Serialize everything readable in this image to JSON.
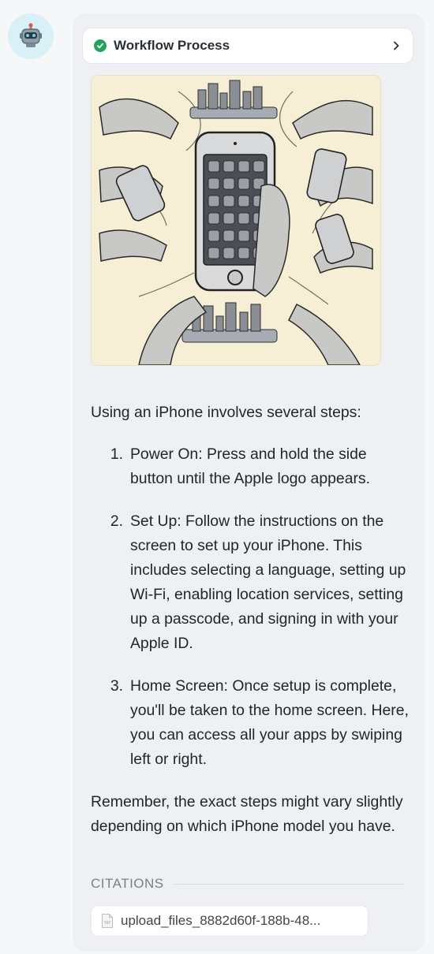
{
  "workflow": {
    "label": "Workflow Process",
    "status": "completed"
  },
  "hero_image": {
    "semantic": "iphone-usage-illustration"
  },
  "message": {
    "intro": "Using an iPhone involves several steps:",
    "steps": [
      {
        "num": "1.",
        "text": "Power On: Press and hold the side button until the Apple logo appears."
      },
      {
        "num": "2.",
        "text": "Set Up: Follow the instructions on the screen to set up your iPhone. This includes selecting a language, setting up Wi-Fi, enabling location services, setting up a passcode, and signing in with your Apple ID."
      },
      {
        "num": "3.",
        "text": "Home Screen: Once setup is complete, you'll be taken to the home screen. Here, you can access all your apps by swiping left or right."
      }
    ],
    "outro": "Remember, the exact steps might vary slightly depending on which iPhone model you have."
  },
  "citations": {
    "label": "CITATIONS",
    "items": [
      {
        "name": "upload_files_8882d60f-188b-48...",
        "icon": "txt-file-icon"
      }
    ]
  },
  "colors": {
    "accent_check": "#22a55b",
    "bubble_bg": "#eef0f4",
    "avatar_bg": "#d9f1f6"
  }
}
